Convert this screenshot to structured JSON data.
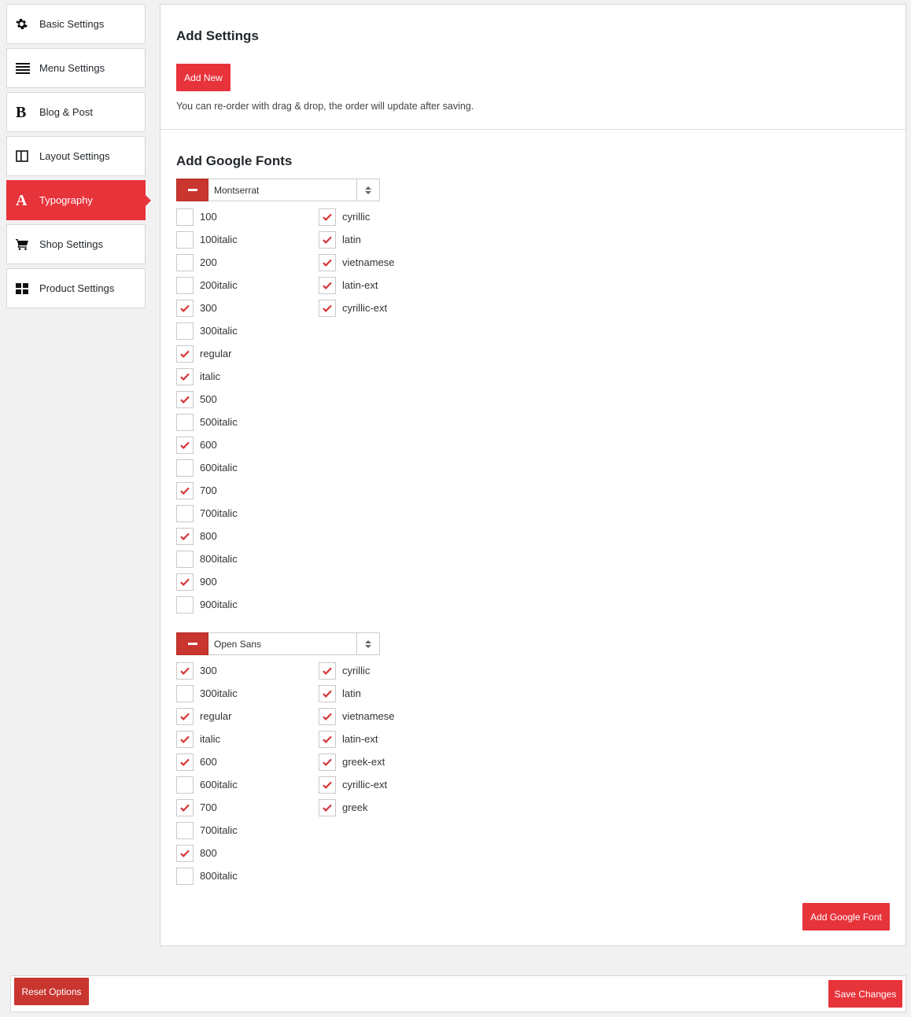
{
  "sidebar": {
    "items": [
      {
        "label": "Basic Settings",
        "icon": "gear-icon",
        "active": false
      },
      {
        "label": "Menu Settings",
        "icon": "menu-lines-icon",
        "active": false
      },
      {
        "label": "Blog & Post",
        "icon": "bold-b-icon",
        "active": false
      },
      {
        "label": "Layout Settings",
        "icon": "layout-columns-icon",
        "active": false
      },
      {
        "label": "Typography",
        "icon": "letter-a-icon",
        "active": true
      },
      {
        "label": "Shop Settings",
        "icon": "cart-icon",
        "active": false
      },
      {
        "label": "Product Settings",
        "icon": "grid-blocks-icon",
        "active": false
      }
    ]
  },
  "main": {
    "add_settings_title": "Add Settings",
    "add_new_label": "Add New",
    "hint": "You can re-order with drag & drop, the order will update after saving.",
    "google_fonts_title": "Add Google Fonts",
    "add_google_font_label": "Add Google Font",
    "fonts": [
      {
        "family": "Montserrat",
        "variants": [
          {
            "label": "100",
            "checked": false
          },
          {
            "label": "100italic",
            "checked": false
          },
          {
            "label": "200",
            "checked": false
          },
          {
            "label": "200italic",
            "checked": false
          },
          {
            "label": "300",
            "checked": true
          },
          {
            "label": "300italic",
            "checked": false
          },
          {
            "label": "regular",
            "checked": true
          },
          {
            "label": "italic",
            "checked": true
          },
          {
            "label": "500",
            "checked": true
          },
          {
            "label": "500italic",
            "checked": false
          },
          {
            "label": "600",
            "checked": true
          },
          {
            "label": "600italic",
            "checked": false
          },
          {
            "label": "700",
            "checked": true
          },
          {
            "label": "700italic",
            "checked": false
          },
          {
            "label": "800",
            "checked": true
          },
          {
            "label": "800italic",
            "checked": false
          },
          {
            "label": "900",
            "checked": true
          },
          {
            "label": "900italic",
            "checked": false
          }
        ],
        "subsets": [
          {
            "label": "cyrillic",
            "checked": true
          },
          {
            "label": "latin",
            "checked": true
          },
          {
            "label": "vietnamese",
            "checked": true
          },
          {
            "label": "latin-ext",
            "checked": true
          },
          {
            "label": "cyrillic-ext",
            "checked": true
          }
        ]
      },
      {
        "family": "Open Sans",
        "variants": [
          {
            "label": "300",
            "checked": true
          },
          {
            "label": "300italic",
            "checked": false
          },
          {
            "label": "regular",
            "checked": true
          },
          {
            "label": "italic",
            "checked": true
          },
          {
            "label": "600",
            "checked": true
          },
          {
            "label": "600italic",
            "checked": false
          },
          {
            "label": "700",
            "checked": true
          },
          {
            "label": "700italic",
            "checked": false
          },
          {
            "label": "800",
            "checked": true
          },
          {
            "label": "800italic",
            "checked": false
          }
        ],
        "subsets": [
          {
            "label": "cyrillic",
            "checked": true
          },
          {
            "label": "latin",
            "checked": true
          },
          {
            "label": "vietnamese",
            "checked": true
          },
          {
            "label": "latin-ext",
            "checked": true
          },
          {
            "label": "greek-ext",
            "checked": true
          },
          {
            "label": "cyrillic-ext",
            "checked": true
          },
          {
            "label": "greek",
            "checked": true
          }
        ]
      }
    ]
  },
  "footer": {
    "reset_label": "Reset Options",
    "save_label": "Save Changes"
  },
  "colors": {
    "accent": "#e7333a",
    "remove": "#c9362f",
    "reset": "#c9362f"
  }
}
